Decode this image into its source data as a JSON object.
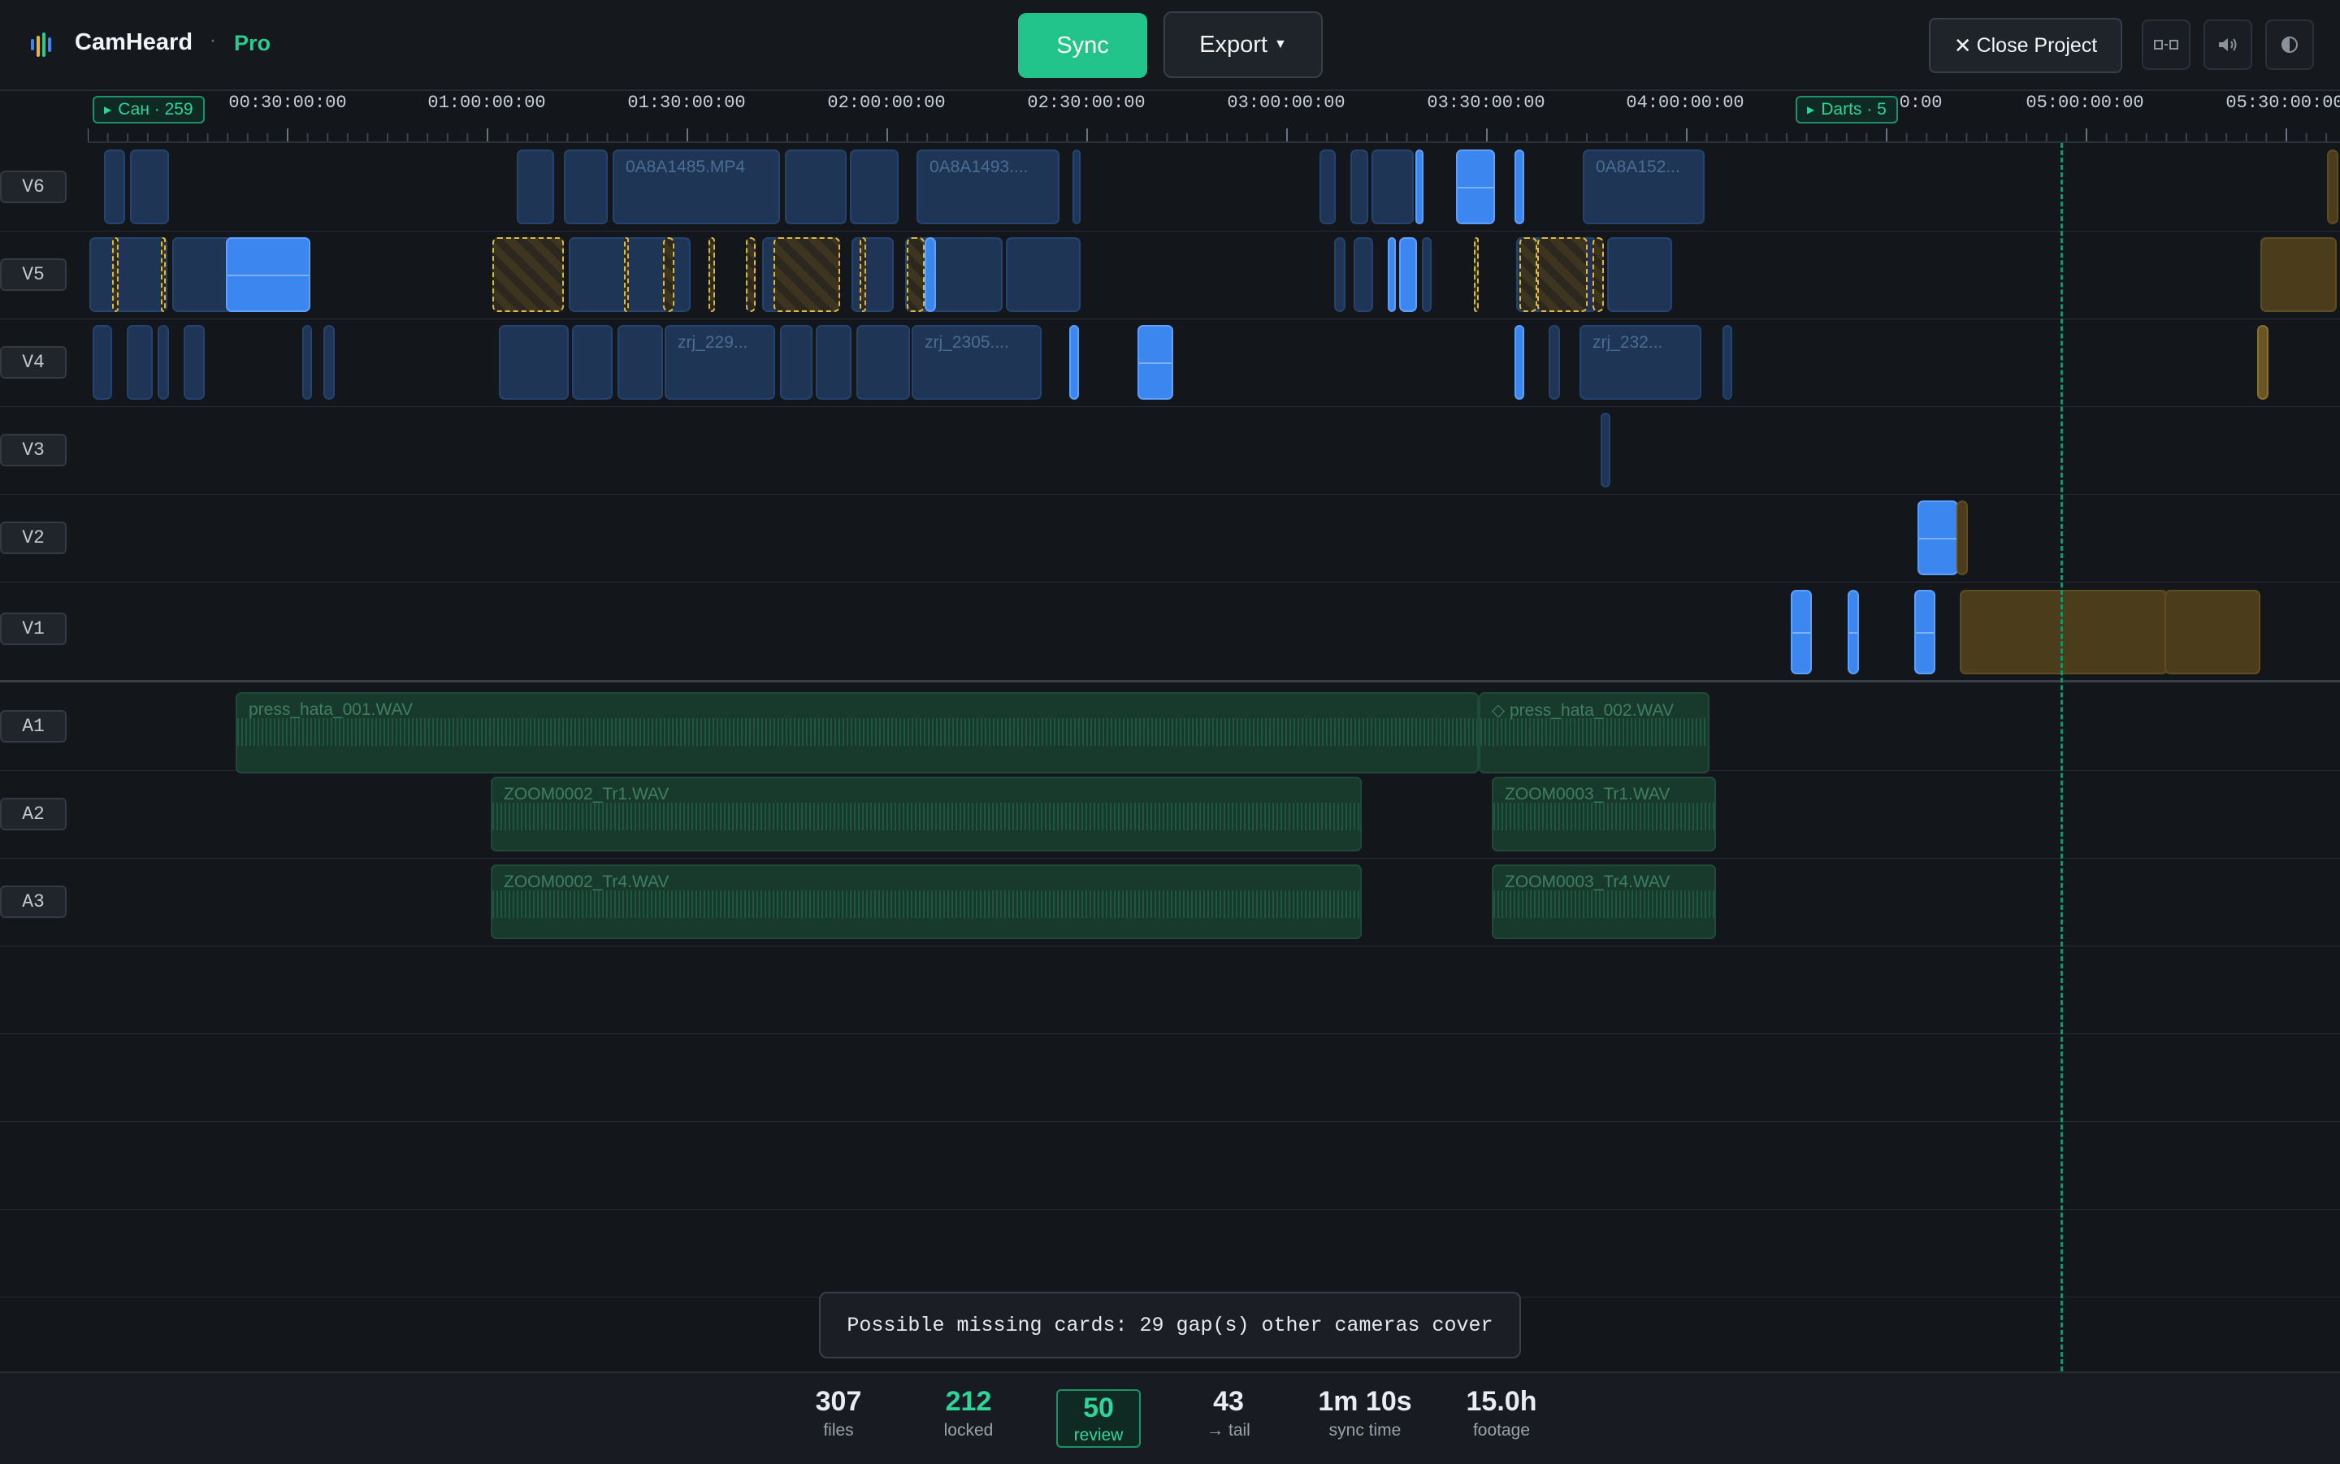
{
  "app": {
    "name": "CamHeard",
    "separator": "·",
    "plan": "Pro"
  },
  "toolbar": {
    "sync_label": "Sync",
    "export_label": "Export",
    "close_label": "Close Project"
  },
  "icons": {
    "logo": "waveform-logo-icon",
    "split": "split-view-icon",
    "volume": "volume-icon",
    "theme": "theme-toggle-icon"
  },
  "ruler": {
    "labels": [
      "00:30:00:00",
      "01:00:00:00",
      "01:30:00:00",
      "02:00:00:00",
      "02:30:00:00",
      "03:00:00:00",
      "03:30:00:00",
      "04:00:00:00",
      "0:00",
      "05:00:00:00",
      "05:30:00:00"
    ],
    "markers": [
      {
        "label": "Сан · 259"
      },
      {
        "label": "Darts · 5"
      }
    ]
  },
  "tracks": {
    "video": [
      "V6",
      "V5",
      "V4",
      "V3",
      "V2",
      "V1"
    ],
    "audio": [
      "A1",
      "A2",
      "A3"
    ]
  },
  "clip_names": {
    "v6_a": "0A8A1485.MP4",
    "v6_b": "0A8A1493....",
    "v6_c": "0A8A152...",
    "v4_a": "zrj_229...",
    "v4_b": "zrj_2305....",
    "v4_c": "zrj_232...",
    "a1_a": "press_hata_001.WAV",
    "a1_b": "◇ press_hata_002.WAV",
    "a2_a": "ZOOM0002_Tr1.WAV",
    "a2_b": "ZOOM0003_Tr1.WAV",
    "a3_a": "ZOOM0002_Tr4.WAV",
    "a3_b": "ZOOM0003_Tr4.WAV"
  },
  "toast": {
    "message": "Possible missing cards: 29 gap(s) other cameras cover"
  },
  "stats": [
    {
      "value": "307",
      "label": "files"
    },
    {
      "value": "212",
      "label": "locked"
    },
    {
      "value": "50",
      "label": "review"
    },
    {
      "value": "43",
      "label": "→ tail"
    },
    {
      "value": "1m 10s",
      "label": "sync time"
    },
    {
      "value": "15.0h",
      "label": "footage"
    }
  ],
  "colors": {
    "accent": "#23c48b",
    "clip_dim": "#1e3556",
    "clip_bright": "#3b86ef",
    "clip_gold": "#4b3d1c",
    "audio": "#173a2d"
  }
}
